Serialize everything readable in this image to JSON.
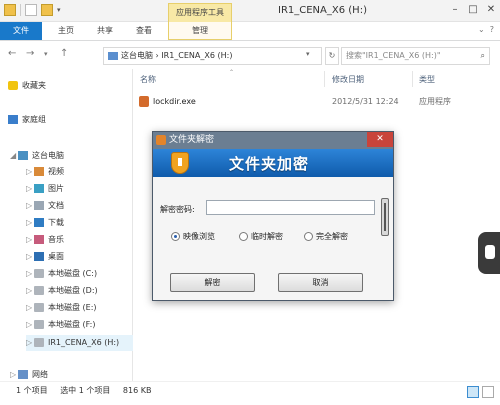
{
  "titlebar": {
    "context_tab": "应用程序工具",
    "window_title": "IR1_CENA_X6 (H:)",
    "controls": [
      "–",
      "□",
      "✕"
    ]
  },
  "ribbon": {
    "tabs": [
      "文件",
      "主页",
      "共享",
      "查看",
      "管理"
    ],
    "right_controls": [
      "⌄",
      "?"
    ]
  },
  "nav": {
    "back": "←",
    "forward": "→",
    "up": "↑",
    "path": "这台电脑 › IR1_CENA_X6 (H:)",
    "search_placeholder": "搜索\"IR1_CENA_X6 (H:)\"",
    "search_icon": "search-icon"
  },
  "sidebar": {
    "items": [
      {
        "label": "收藏夹"
      },
      {
        "label": "家庭组"
      },
      {
        "label": "这台电脑"
      },
      {
        "label": "视频"
      },
      {
        "label": "图片"
      },
      {
        "label": "文档"
      },
      {
        "label": "下载"
      },
      {
        "label": "音乐"
      },
      {
        "label": "桌面"
      },
      {
        "label": "本地磁盘 (C:)"
      },
      {
        "label": "本地磁盘 (D:)"
      },
      {
        "label": "本地磁盘 (E:)"
      },
      {
        "label": "本地磁盘 (F:)"
      },
      {
        "label": "IR1_CENA_X6 (H:)"
      },
      {
        "label": "网络"
      }
    ]
  },
  "content": {
    "columns": [
      "名称",
      "修改日期",
      "类型"
    ],
    "files": [
      {
        "name": "lockdir.exe",
        "date": "2012/5/31 12:24",
        "type": "应用程序"
      }
    ]
  },
  "status": {
    "count": "1 个项目",
    "selected": "选中 1 个项目",
    "size": "816 KB"
  },
  "dialog": {
    "title": "文件夹解密",
    "banner": "文件夹加密",
    "password_label": "解密密码:",
    "password_value": "",
    "options": [
      "映像浏览",
      "临时解密",
      "完全解密"
    ],
    "selected_option": "映像浏览",
    "ok_button": "解密",
    "cancel_button": "取消",
    "close": "✕"
  },
  "colors": {
    "accent": "#1979ca",
    "banner": "#1d6fc4",
    "context_tab": "#f8e9a6"
  }
}
